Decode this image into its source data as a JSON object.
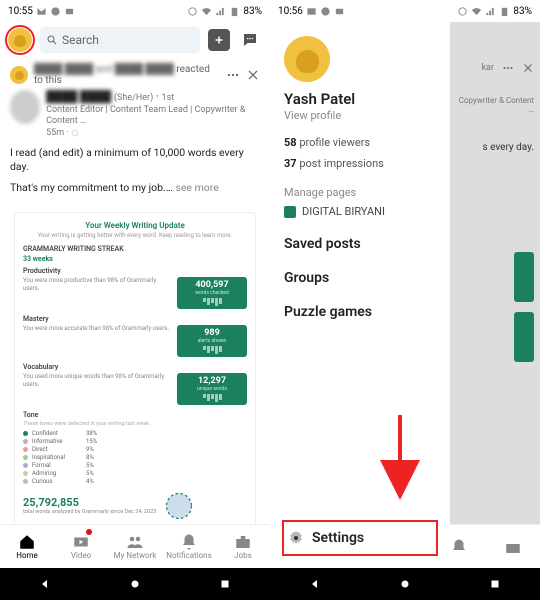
{
  "status": {
    "time_left": "10:55",
    "time_right": "10:56",
    "battery": "83%"
  },
  "search": {
    "placeholder": "Search"
  },
  "notify": {
    "text": "reacted to this"
  },
  "post": {
    "pronoun": "(She/Her)",
    "degree": "1st",
    "role": "Content Editor | Content Team Lead | Copywriter & Content …",
    "age": "55m",
    "line1": "I read (and edit) a minimum of 10,000 words every day.",
    "line2": "That's my commitment to my job.…",
    "seemore": "see more"
  },
  "widget": {
    "title": "Your Weekly Writing Update",
    "streak_label": "GRAMMARLY WRITING STREAK",
    "streak": "33 weeks",
    "rows": [
      {
        "label": "Productivity",
        "desc": "You were more productive than 98% of Grammarly users.",
        "num": "400,597",
        "sub": "words checked"
      },
      {
        "label": "Mastery",
        "desc": "You were more accurate than 98% of Grammarly users.",
        "num": "989",
        "sub": "alerts shown"
      },
      {
        "label": "Vocabulary",
        "desc": "You used more unique words than 98% of Grammarly users.",
        "num": "12,297",
        "sub": "unique words"
      }
    ],
    "tone_label": "Tone",
    "tone_sub": "These tones were detected in your writing last week.",
    "tones": [
      {
        "name": "Confident",
        "pct": "38%",
        "color": "#1a8060"
      },
      {
        "name": "Informative",
        "pct": "15%",
        "color": "#caa"
      },
      {
        "name": "Direct",
        "pct": "9%",
        "color": "#e99"
      },
      {
        "name": "Inspirational",
        "pct": "8%",
        "color": "#9c9"
      },
      {
        "name": "Formal",
        "pct": "5%",
        "color": "#aac"
      },
      {
        "name": "Admiring",
        "pct": "5%",
        "color": "#cc9"
      },
      {
        "name": "Curious",
        "pct": "4%",
        "color": "#bbb"
      }
    ],
    "total_num": "25,792,855",
    "total_sub": "total words analyzed by Grammarly since Dec 24, 2023"
  },
  "nav": {
    "home": "Home",
    "video": "Video",
    "network": "My Network",
    "notif": "Notifications",
    "jobs": "Jobs"
  },
  "drawer": {
    "name": "Yash Patel",
    "view": "View profile",
    "stat1_n": "58",
    "stat1_t": "profile viewers",
    "stat2_n": "37",
    "stat2_t": "post impressions",
    "manage": "Manage pages",
    "page": "DIGITAL BIRYANI",
    "saved": "Saved posts",
    "groups": "Groups",
    "puzzle": "Puzzle games",
    "settings": "Settings"
  },
  "rt": {
    "name_frag": "kar",
    "role": "Copywriter & Content …",
    "body": "s every day."
  }
}
